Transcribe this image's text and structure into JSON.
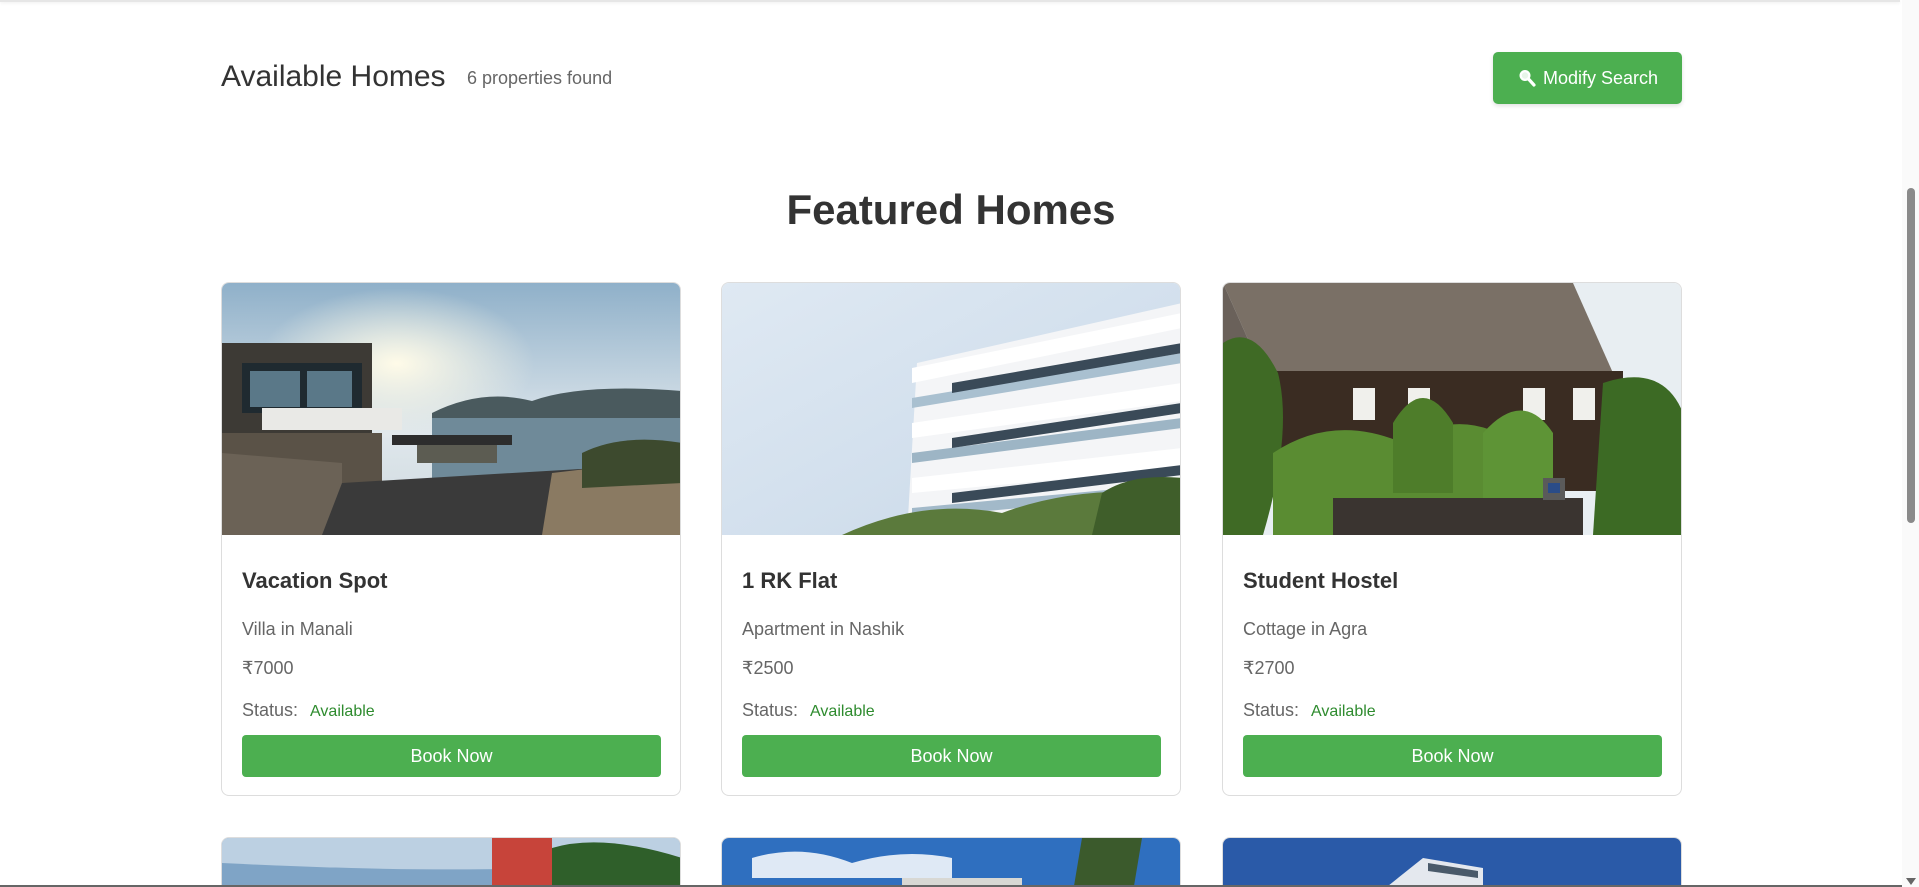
{
  "header": {
    "title": "Available Homes",
    "count": "6 properties found",
    "modify_label": "Modify Search"
  },
  "section_title": "Featured Homes",
  "status_label": "Status:",
  "book_label": "Book Now",
  "homes": [
    {
      "name": "Vacation Spot",
      "type": "Villa in Manali",
      "price": "₹7000",
      "status": "Available"
    },
    {
      "name": "1 RK Flat",
      "type": "Apartment in Nashik",
      "price": "₹2500",
      "status": "Available"
    },
    {
      "name": "Student Hostel",
      "type": "Cottage in Agra",
      "price": "₹2700",
      "status": "Available"
    }
  ],
  "colors": {
    "accent": "#4caf50",
    "status_available": "#2e8b2e"
  }
}
